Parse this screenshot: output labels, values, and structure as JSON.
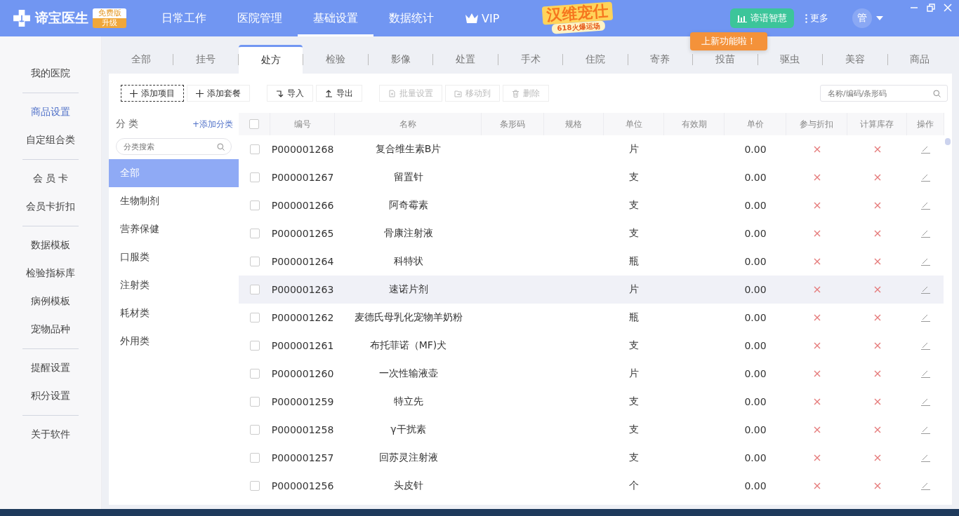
{
  "app": {
    "name": "谛宝医生",
    "edition": "免费版",
    "upgrade": "升级"
  },
  "nav": [
    {
      "label": "日常工作",
      "selected": false,
      "kind": "text"
    },
    {
      "label": "医院管理",
      "selected": false,
      "kind": "text"
    },
    {
      "label": "基础设置",
      "selected": true,
      "kind": "text"
    },
    {
      "label": "数据统计",
      "selected": false,
      "kind": "text"
    },
    {
      "label": "VIP",
      "selected": false,
      "kind": "vip"
    }
  ],
  "promo": {
    "title": "汉维宠仕",
    "subtitle": "618火爆运场"
  },
  "smart_button": "谛语智慧",
  "more_button": "更多",
  "user": "管",
  "tooltip": "上新功能啦！",
  "sidebar": {
    "groups": [
      [
        {
          "label": "我的医院",
          "selected": false
        }
      ],
      [
        {
          "label": "商品设置",
          "selected": true
        },
        {
          "label": "自定组合类",
          "selected": false
        }
      ],
      [
        {
          "label": "会 员 卡",
          "selected": false
        },
        {
          "label": "会员卡折扣",
          "selected": false
        }
      ],
      [
        {
          "label": "数据模板",
          "selected": false
        },
        {
          "label": "检验指标库",
          "selected": false
        },
        {
          "label": "病例模板",
          "selected": false
        },
        {
          "label": "宠物品种",
          "selected": false
        }
      ],
      [
        {
          "label": "提醒设置",
          "selected": false
        },
        {
          "label": "积分设置",
          "selected": false
        }
      ],
      [
        {
          "label": "关于软件",
          "selected": false
        }
      ]
    ]
  },
  "tabs": [
    {
      "label": "全部",
      "selected": false
    },
    {
      "label": "挂号",
      "selected": false
    },
    {
      "label": "处方",
      "selected": true
    },
    {
      "label": "检验",
      "selected": false
    },
    {
      "label": "影像",
      "selected": false
    },
    {
      "label": "处置",
      "selected": false
    },
    {
      "label": "手术",
      "selected": false
    },
    {
      "label": "住院",
      "selected": false
    },
    {
      "label": "寄养",
      "selected": false
    },
    {
      "label": "投苗",
      "selected": false
    },
    {
      "label": "驱虫",
      "selected": false
    },
    {
      "label": "美容",
      "selected": false
    },
    {
      "label": "商品",
      "selected": false
    }
  ],
  "toolbar": [
    {
      "label": "添加项目",
      "kind": "plus",
      "disabled": false,
      "focused": true
    },
    {
      "label": "添加套餐",
      "kind": "plus",
      "disabled": false,
      "focused": false
    },
    {
      "label": "导入",
      "kind": "import",
      "disabled": false,
      "focused": false
    },
    {
      "label": "导出",
      "kind": "export",
      "disabled": false,
      "focused": false
    },
    {
      "label": "批量设置",
      "kind": "batch",
      "disabled": true,
      "focused": false
    },
    {
      "label": "移动到",
      "kind": "move",
      "disabled": true,
      "focused": false
    },
    {
      "label": "删除",
      "kind": "trash",
      "disabled": true,
      "focused": false
    }
  ],
  "search": {
    "placeholder": "名称/编码/条形码"
  },
  "categories": {
    "title": "分 类",
    "add_link": "+添加分类",
    "search_placeholder": "分类搜索",
    "items": [
      {
        "label": "全部",
        "selected": true
      },
      {
        "label": "生物制剂",
        "selected": false
      },
      {
        "label": "营养保健",
        "selected": false
      },
      {
        "label": "口服类",
        "selected": false
      },
      {
        "label": "注射类",
        "selected": false
      },
      {
        "label": "耗材类",
        "selected": false
      },
      {
        "label": "外用类",
        "selected": false
      }
    ]
  },
  "table": {
    "all_checked": false,
    "columns": [
      "编号",
      "名称",
      "条形码",
      "规格",
      "单位",
      "有效期",
      "单价",
      "参与折扣",
      "计算库存",
      "操作"
    ],
    "rows": [
      {
        "code": "P000001268",
        "name": "复合维生素B片",
        "unit": "片",
        "price": "0.00",
        "discount": false,
        "stock": false,
        "checked": false,
        "highlighted": false
      },
      {
        "code": "P000001267",
        "name": "留置针",
        "unit": "支",
        "price": "0.00",
        "discount": false,
        "stock": false,
        "checked": false,
        "highlighted": false
      },
      {
        "code": "P000001266",
        "name": "阿奇霉素",
        "unit": "支",
        "price": "0.00",
        "discount": false,
        "stock": false,
        "checked": false,
        "highlighted": false
      },
      {
        "code": "P000001265",
        "name": "骨康注射液",
        "unit": "支",
        "price": "0.00",
        "discount": false,
        "stock": false,
        "checked": false,
        "highlighted": false
      },
      {
        "code": "P000001264",
        "name": "科特状",
        "unit": "瓶",
        "price": "0.00",
        "discount": false,
        "stock": false,
        "checked": false,
        "highlighted": false
      },
      {
        "code": "P000001263",
        "name": "速诺片剂",
        "unit": "片",
        "price": "0.00",
        "discount": false,
        "stock": false,
        "checked": false,
        "highlighted": true
      },
      {
        "code": "P000001262",
        "name": "麦德氏母乳化宠物羊奶粉",
        "unit": "瓶",
        "price": "0.00",
        "discount": false,
        "stock": false,
        "checked": false,
        "highlighted": false
      },
      {
        "code": "P000001261",
        "name": "布托菲诺（MF)犬",
        "unit": "支",
        "price": "0.00",
        "discount": false,
        "stock": false,
        "checked": false,
        "highlighted": false
      },
      {
        "code": "P000001260",
        "name": "一次性输液壶",
        "unit": "片",
        "price": "0.00",
        "discount": false,
        "stock": false,
        "checked": false,
        "highlighted": false
      },
      {
        "code": "P000001259",
        "name": "特立先",
        "unit": "支",
        "price": "0.00",
        "discount": false,
        "stock": false,
        "checked": false,
        "highlighted": false
      },
      {
        "code": "P000001258",
        "name": "γ干扰素",
        "unit": "支",
        "price": "0.00",
        "discount": false,
        "stock": false,
        "checked": false,
        "highlighted": false
      },
      {
        "code": "P000001257",
        "name": "回苏灵注射液",
        "unit": "支",
        "price": "0.00",
        "discount": false,
        "stock": false,
        "checked": false,
        "highlighted": false
      },
      {
        "code": "P000001256",
        "name": "头皮针",
        "unit": "个",
        "price": "0.00",
        "discount": false,
        "stock": false,
        "checked": false,
        "highlighted": false
      }
    ]
  }
}
